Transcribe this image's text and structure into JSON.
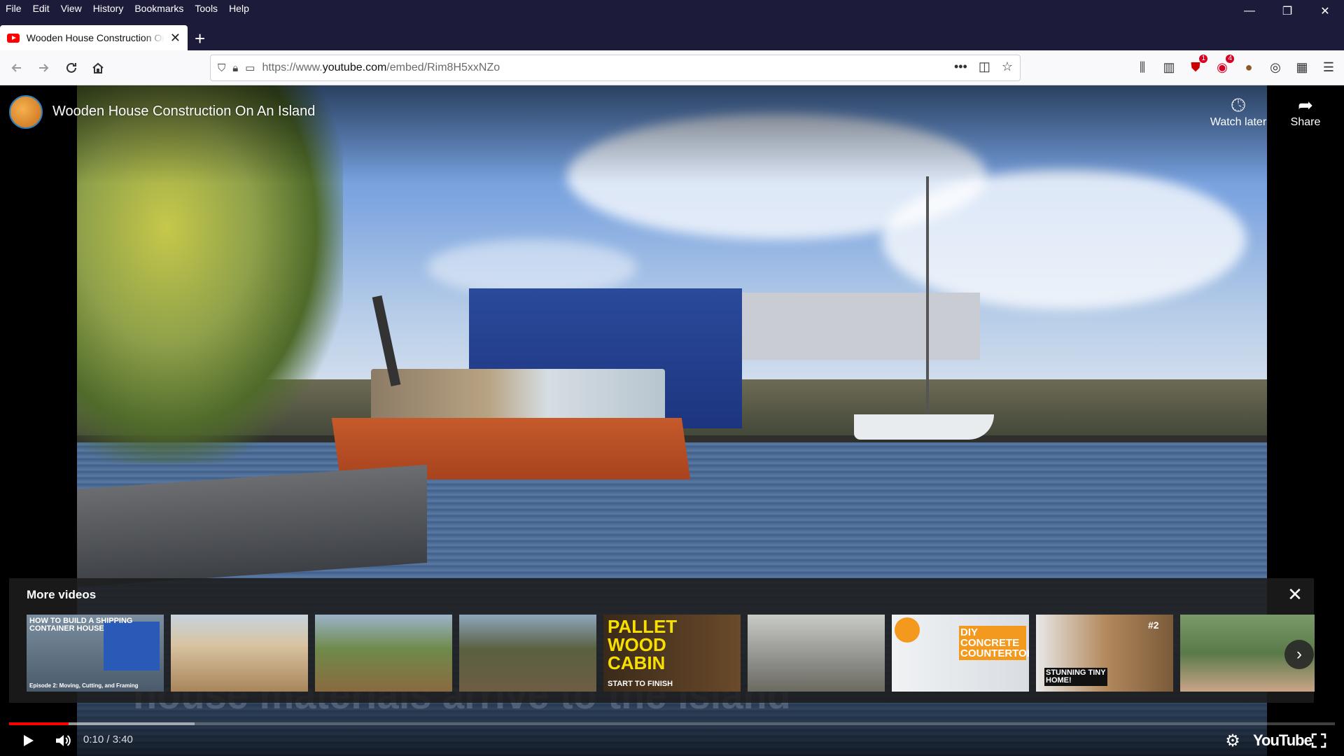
{
  "menubar": {
    "items": [
      "File",
      "Edit",
      "View",
      "History",
      "Bookmarks",
      "Tools",
      "Help"
    ]
  },
  "window": {
    "minimize": "—",
    "restore": "❐",
    "close": "✕"
  },
  "tab": {
    "title": "Wooden House Construction On An Island",
    "close": "✕",
    "new_tab": "+"
  },
  "nav": {
    "url_prefix": "https://www.",
    "url_domain": "youtube.com",
    "url_path": "/embed/Rim8H5xxNZo",
    "badges": {
      "ublock": "1",
      "privacy": "4"
    }
  },
  "player": {
    "video_title": "Wooden House Construction On An Island",
    "watch_later": "Watch later",
    "share": "Share",
    "subtitle_overlay": "house materials arrive to the island",
    "more_videos_title": "More videos",
    "more_close": "✕",
    "next": "›",
    "time": "0:10 / 3:40",
    "logo": "YouTube",
    "progress_played": 0.045,
    "progress_loaded": 0.14
  },
  "thumbnails": [
    {
      "caption": "HOW TO BUILD A SHIPPING CONTAINER HOUSE",
      "sub": "Episode 2: Moving, Cutting, and Framing",
      "color": "#6a7c8c"
    },
    {
      "caption": "",
      "sub": "",
      "color": "#b99a6e"
    },
    {
      "caption": "",
      "sub": "",
      "color": "#6f8a4a"
    },
    {
      "caption": "",
      "sub": "",
      "color": "#6d5d45"
    },
    {
      "caption": "PALLET WOOD CABIN",
      "sub": "START TO FINISH",
      "color": "#3a2a1a"
    },
    {
      "caption": "",
      "sub": "",
      "color": "#8e8f8a"
    },
    {
      "caption": "DIY CONCRETE COUNTERTOP",
      "sub": "",
      "color": "#e8ecef"
    },
    {
      "caption": "STUNNING TINY HOME!",
      "sub": "#2",
      "color": "#b48a5e"
    },
    {
      "caption": "",
      "sub": "",
      "color": "#5a7a4a"
    }
  ],
  "colors": {
    "chrome_dark": "#1c1b3a",
    "yt_red": "#ff0000"
  }
}
